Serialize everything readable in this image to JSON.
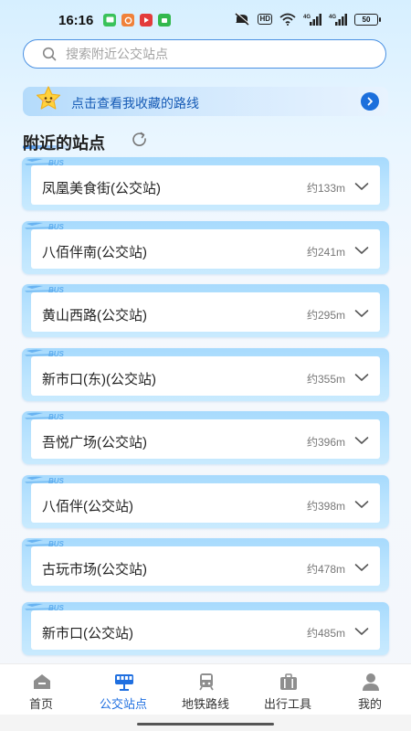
{
  "status_bar": {
    "time": "16:16",
    "battery": "50",
    "hd_label": "HD",
    "signal_label_1": "4G",
    "signal_label_2": "4G",
    "notification_colors": [
      "#3ac25a",
      "#f0813a",
      "#e33b3b",
      "#33b84d"
    ]
  },
  "search": {
    "placeholder": "搜索附近公交站点"
  },
  "favorites": {
    "label": "点击查看我收藏的路线"
  },
  "section": {
    "title": "附近的站点"
  },
  "stops": [
    {
      "name": "凤凰美食街(公交站)",
      "distance": "约133m"
    },
    {
      "name": "八佰伴南(公交站)",
      "distance": "约241m"
    },
    {
      "name": "黄山西路(公交站)",
      "distance": "约295m"
    },
    {
      "name": "新市口(东)(公交站)",
      "distance": "约355m"
    },
    {
      "name": "吾悦广场(公交站)",
      "distance": "约396m"
    },
    {
      "name": "八佰伴(公交站)",
      "distance": "约398m"
    },
    {
      "name": "古玩市场(公交站)",
      "distance": "约478m"
    },
    {
      "name": "新市口(公交站)",
      "distance": "约485m"
    }
  ],
  "bus_logo_text": "BUS",
  "tabs": [
    {
      "label": "首页",
      "icon": "home-icon"
    },
    {
      "label": "公交站点",
      "icon": "bus-icon",
      "active": true
    },
    {
      "label": "地铁路线",
      "icon": "subway-icon"
    },
    {
      "label": "出行工具",
      "icon": "toolbox-icon"
    },
    {
      "label": "我的",
      "icon": "profile-icon"
    }
  ],
  "colors": {
    "accent": "#1f6fe0",
    "card_bg": "#b5e0fd",
    "search_border": "#4a90e2"
  }
}
